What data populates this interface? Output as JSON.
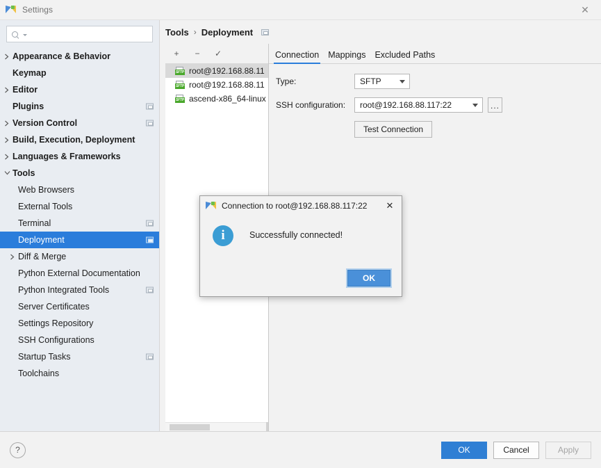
{
  "window": {
    "title": "Settings",
    "icon": "pycharm-logo-icon",
    "close_label": "✕"
  },
  "search": {
    "value": "",
    "placeholder": ""
  },
  "sidebar": {
    "items": [
      {
        "label": "Appearance & Behavior",
        "level": 0,
        "arrow": "collapsed",
        "badge": false,
        "selected": false
      },
      {
        "label": "Keymap",
        "level": 0,
        "arrow": "none",
        "badge": false,
        "selected": false
      },
      {
        "label": "Editor",
        "level": 0,
        "arrow": "collapsed",
        "badge": false,
        "selected": false
      },
      {
        "label": "Plugins",
        "level": 0,
        "arrow": "none",
        "badge": true,
        "selected": false
      },
      {
        "label": "Version Control",
        "level": 0,
        "arrow": "collapsed",
        "badge": true,
        "selected": false
      },
      {
        "label": "Build, Execution, Deployment",
        "level": 0,
        "arrow": "collapsed",
        "badge": false,
        "selected": false
      },
      {
        "label": "Languages & Frameworks",
        "level": 0,
        "arrow": "collapsed",
        "badge": false,
        "selected": false
      },
      {
        "label": "Tools",
        "level": 0,
        "arrow": "expanded",
        "badge": false,
        "selected": false
      },
      {
        "label": "Web Browsers",
        "level": 1,
        "arrow": "none",
        "badge": false,
        "selected": false
      },
      {
        "label": "External Tools",
        "level": 1,
        "arrow": "none",
        "badge": false,
        "selected": false
      },
      {
        "label": "Terminal",
        "level": 1,
        "arrow": "none",
        "badge": true,
        "selected": false
      },
      {
        "label": "Deployment",
        "level": 1,
        "arrow": "none",
        "badge": true,
        "selected": true
      },
      {
        "label": "Diff & Merge",
        "level": 1,
        "arrow": "collapsed",
        "badge": false,
        "selected": false
      },
      {
        "label": "Python External Documentation",
        "level": 1,
        "arrow": "none",
        "badge": false,
        "selected": false
      },
      {
        "label": "Python Integrated Tools",
        "level": 1,
        "arrow": "none",
        "badge": true,
        "selected": false
      },
      {
        "label": "Server Certificates",
        "level": 1,
        "arrow": "none",
        "badge": false,
        "selected": false
      },
      {
        "label": "Settings Repository",
        "level": 1,
        "arrow": "none",
        "badge": false,
        "selected": false
      },
      {
        "label": "SSH Configurations",
        "level": 1,
        "arrow": "none",
        "badge": false,
        "selected": false
      },
      {
        "label": "Startup Tasks",
        "level": 1,
        "arrow": "none",
        "badge": true,
        "selected": false
      },
      {
        "label": "Toolchains",
        "level": 1,
        "arrow": "none",
        "badge": false,
        "selected": false
      }
    ]
  },
  "main": {
    "breadcrumb": {
      "parent": "Tools",
      "separator": "›",
      "current": "Deployment"
    },
    "list_toolbar": {
      "add_label": "+",
      "remove_label": "−",
      "default_label": "✓"
    },
    "servers": [
      {
        "name": "root@192.168.88.11",
        "type_tag": "SFTP",
        "selected": true
      },
      {
        "name": "root@192.168.88.11",
        "type_tag": "SFTP",
        "selected": false
      },
      {
        "name": "ascend-x86_64-linux",
        "type_tag": "SFTP",
        "selected": false
      }
    ],
    "tabs": [
      {
        "label": "Connection",
        "active": true
      },
      {
        "label": "Mappings",
        "active": false
      },
      {
        "label": "Excluded Paths",
        "active": false
      }
    ],
    "form": {
      "type_label": "Type:",
      "type_value": "SFTP",
      "ssh_label": "SSH configuration:",
      "ssh_value": "root@192.168.88.117:22",
      "ssh_browse_label": "...",
      "test_connection_label": "Test Connection"
    }
  },
  "bottom": {
    "help_label": "?",
    "ok_label": "OK",
    "cancel_label": "Cancel",
    "apply_label": "Apply"
  },
  "dialog": {
    "icon": "pycharm-logo-icon",
    "title": "Connection to root@192.168.88.117:22",
    "close_label": "✕",
    "info_glyph": "i",
    "message": "Successfully connected!",
    "ok_label": "OK"
  },
  "colors": {
    "accent_blue": "#2b7ddb",
    "selection_blue": "#2b7ddb",
    "primary_button": "#2f7fd4",
    "dialog_button": "#4a90d9",
    "info_icon": "#3b9dd4",
    "sftp_tag_green": "#4aa82c",
    "sidebar_bg": "#e9edf2",
    "window_bg": "#f2f2f2"
  }
}
